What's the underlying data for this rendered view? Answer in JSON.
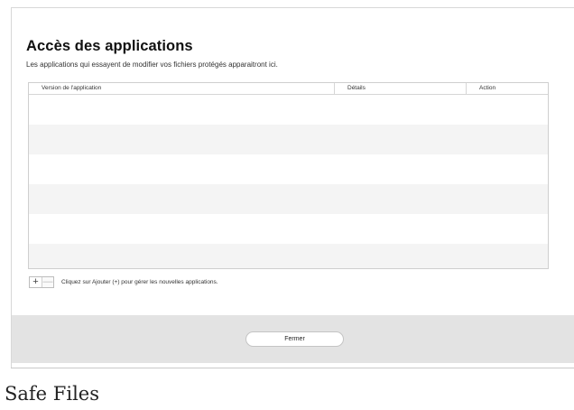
{
  "dialog": {
    "title": "Accès des applications",
    "subtitle": "Les applications qui essayent de modifier vos fichiers protégés apparaitront ici."
  },
  "table": {
    "columns": [
      "Version de l'application",
      "Détails",
      "Action"
    ],
    "rows": [
      [],
      [],
      [],
      [],
      [],
      []
    ]
  },
  "controls": {
    "add_label": "+",
    "remove_label": "—",
    "hint": "Cliquez sur Ajouter (+) pour gérer les nouvelles applications."
  },
  "footer": {
    "close_label": "Fermer"
  },
  "caption": "Safe Files"
}
